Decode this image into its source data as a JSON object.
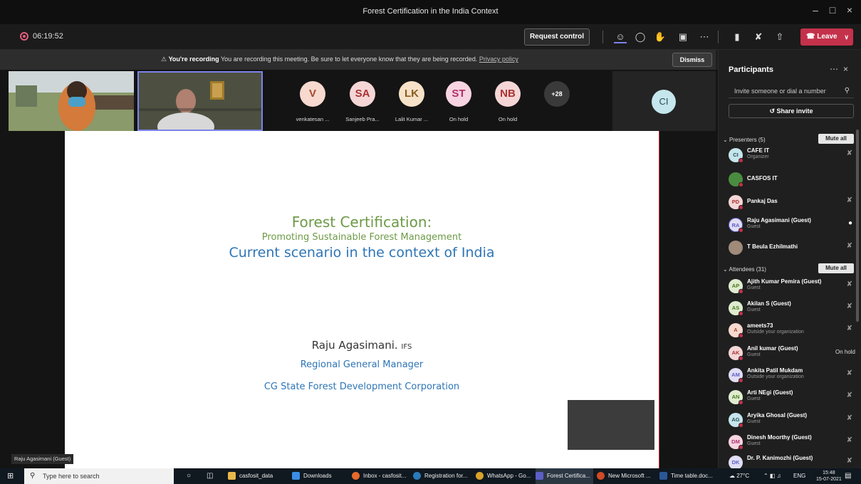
{
  "window": {
    "title": "Forest Certification in the India Context"
  },
  "meeting": {
    "timer": "06:19:52",
    "request_control": "Request control",
    "leave": "Leave"
  },
  "recording_banner": {
    "bold": "You're recording",
    "text": "You are recording this meeting. Be sure to let everyone know that they are being recorded.",
    "link": "Privacy policy",
    "dismiss": "Dismiss"
  },
  "avatars": [
    {
      "initials": "V",
      "label": "venkatesan ...",
      "bg": "#f7d9cf",
      "fg": "#a04a2a"
    },
    {
      "initials": "SA",
      "label": "Sanjeeb Pra...",
      "bg": "#f5d6d6",
      "fg": "#a33"
    },
    {
      "initials": "LK",
      "label": "Lalit Kumar ...",
      "bg": "#f6e2c8",
      "fg": "#8a5a1c"
    },
    {
      "initials": "ST",
      "label": "On hold",
      "bg": "#f7d4e2",
      "fg": "#b0306a"
    },
    {
      "initials": "NB",
      "label": "On hold",
      "bg": "#f5d6d6",
      "fg": "#a33"
    }
  ],
  "overflow_count": "+28",
  "ci_initials": "CI",
  "slide": {
    "title": "Forest Certification:",
    "subtitle": "Promoting Sustainable Forest Management",
    "heading": "Current scenario in the context of India",
    "presenter": "Raju Agasimani.",
    "presenter_suffix": "IFS",
    "role": "Regional General Manager",
    "org": "CG State Forest Development Corporation"
  },
  "speaker_tag": "Raju Agasimani (Guest)",
  "panel": {
    "title": "Participants",
    "invite_placeholder": "Invite someone or dial a number",
    "share": "Share invite",
    "presenters_label": "Presenters (5)",
    "attendees_label": "Attendees (31)",
    "mute_all": "Mute all",
    "presenters": [
      {
        "initials": "CI",
        "name": "CAFE IT",
        "sub": "Organizer",
        "bg": "#c5e6ec",
        "fg": "#2d4b55"
      },
      {
        "initials": "",
        "name": "CASFOS IT",
        "sub": "",
        "bg": "#4a8c3f",
        "fg": "#fff"
      },
      {
        "initials": "PD",
        "name": "Pankaj Das",
        "sub": "",
        "bg": "#f5d6d6",
        "fg": "#a33"
      },
      {
        "initials": "RA",
        "name": "Raju Agasimani (Guest)",
        "sub": "Guest",
        "bg": "#e0ddf5",
        "fg": "#5b5fc7"
      },
      {
        "initials": "",
        "name": "T Beula Ezhilmathi",
        "sub": "",
        "bg": "#a08a7a",
        "fg": "#fff"
      }
    ],
    "attendees": [
      {
        "initials": "AP",
        "name": "Ajith Kumar Pemira (Guest)",
        "sub": "Guest",
        "bg": "#dfecd0",
        "fg": "#4a7a1c",
        "hold": ""
      },
      {
        "initials": "AS",
        "name": "Akilan S (Guest)",
        "sub": "Guest",
        "bg": "#dfecd0",
        "fg": "#4a7a1c",
        "hold": ""
      },
      {
        "initials": "A",
        "name": "ameets73",
        "sub": "Outside your organization",
        "bg": "#f7d9cf",
        "fg": "#a04a2a",
        "hold": ""
      },
      {
        "initials": "AK",
        "name": "Anil kumar (Guest)",
        "sub": "Guest",
        "bg": "#f5d6d6",
        "fg": "#a33",
        "hold": "On hold"
      },
      {
        "initials": "AM",
        "name": "Ankita Patil Mukdam",
        "sub": "Outside your organization",
        "bg": "#e0ddf5",
        "fg": "#5b5fc7",
        "hold": ""
      },
      {
        "initials": "AN",
        "name": "Arti NEgi (Guest)",
        "sub": "Guest",
        "bg": "#dfecd0",
        "fg": "#4a7a1c",
        "hold": ""
      },
      {
        "initials": "AG",
        "name": "Aryika Ghosal (Guest)",
        "sub": "Guest",
        "bg": "#c5e6ec",
        "fg": "#2d4b55",
        "hold": ""
      },
      {
        "initials": "DM",
        "name": "Dinesh Moorthy (Guest)",
        "sub": "Guest",
        "bg": "#f7d4e2",
        "fg": "#b0306a",
        "hold": ""
      },
      {
        "initials": "DK",
        "name": "Dr. P. Kanimozhi (Guest)",
        "sub": "",
        "bg": "#e0ddf5",
        "fg": "#5b5fc7",
        "hold": ""
      }
    ]
  },
  "taskbar": {
    "search_placeholder": "Type here to search",
    "items": [
      {
        "label": "casfosit_data",
        "color": "#e8b84a"
      },
      {
        "label": "Downloads",
        "color": "#3a8ee6"
      },
      {
        "label": "Inbox - casfosit...",
        "color": "#e66a2c"
      },
      {
        "label": "Registration for...",
        "color": "#2a7ab8"
      },
      {
        "label": "WhatsApp - Go...",
        "color": "#d8a32a"
      },
      {
        "label": "Forest Certifica...",
        "color": "#5b5fc7"
      },
      {
        "label": "New Microsoft ...",
        "color": "#d04a26"
      },
      {
        "label": "Time table.doc...",
        "color": "#2b5797"
      }
    ],
    "weather": "27°C",
    "lang": "ENG",
    "time": "15:48",
    "date": "15-07-2021"
  }
}
